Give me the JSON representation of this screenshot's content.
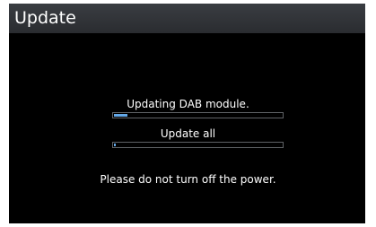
{
  "window": {
    "title": "Update"
  },
  "progress": {
    "module": {
      "label": "Updating DAB module.",
      "fraction": 0.04
    },
    "all": {
      "label": "Update all",
      "fraction": 0.01
    }
  },
  "notice": "Please do not turn off the power.",
  "colors": {
    "background": "#000000",
    "titlebar": "#35383c",
    "progress_fill": "#63a8e8",
    "progress_border": "#5f6266",
    "text": "#ffffff"
  }
}
